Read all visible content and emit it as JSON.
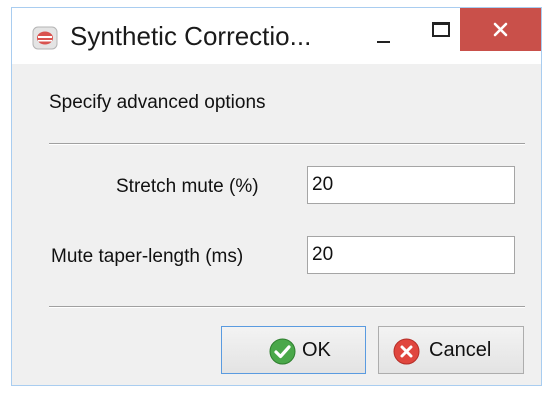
{
  "window": {
    "title": "Synthetic Correctio...",
    "icons": {
      "app": "app-icon",
      "minimize": "minimize-icon",
      "maximize": "maximize-icon",
      "close": "close-icon"
    },
    "colors": {
      "close_button": "#c9504a",
      "ok_accent": "#5a9be0"
    }
  },
  "dialog": {
    "instruction": "Specify advanced options",
    "fields": [
      {
        "label": "Stretch mute (%)",
        "value": "20"
      },
      {
        "label": "Mute taper-length (ms)",
        "value": "20"
      }
    ]
  },
  "buttons": {
    "ok_label": "OK",
    "cancel_label": "Cancel",
    "ok_icon": "check-icon",
    "cancel_icon": "cancel-x-icon"
  }
}
